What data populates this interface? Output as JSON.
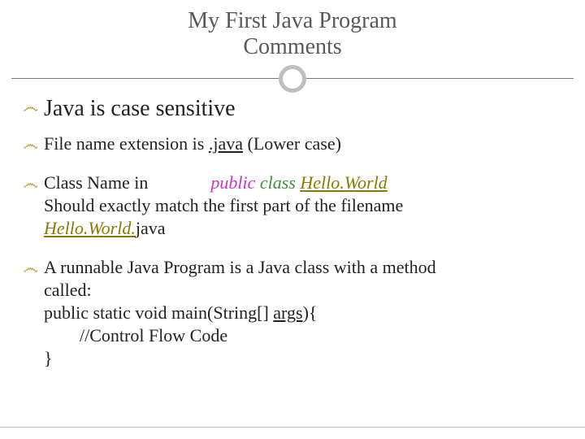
{
  "slide": {
    "title_line1": "My First Java Program",
    "title_line2": "Comments",
    "bullets": {
      "b0": "Java is case sensitive",
      "b1_pre": "File name extension is ",
      "b1_ext": ".java",
      "b1_post": " (Lower case)",
      "b2_pre": "Class Name in              ",
      "b2_kw1": "public",
      "b2_sp1": " ",
      "b2_kw2": "class",
      "b2_sp2": " ",
      "b2_cls": "Hello.World",
      "b2_line2": "Should exactly match the first part of the filename",
      "b2_line3a": "Hello.World.",
      "b2_line3b": "java",
      "b3": "A runnable Java Program is a Java class with a method",
      "b3_l2": "called:",
      "b3_l3_a": "public static void main(String[] ",
      "b3_l3_b": "args",
      "b3_l3_c": "){",
      "b3_l4": "        //Control Flow Code",
      "b3_l5": "}"
    }
  }
}
